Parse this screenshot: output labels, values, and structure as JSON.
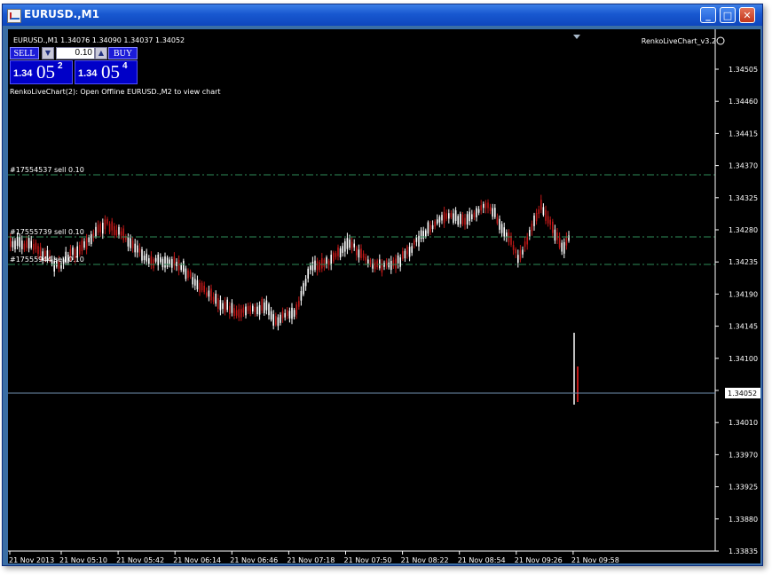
{
  "window": {
    "title": "EURUSD.,M1",
    "minimize_glyph": "_",
    "maximize_glyph": "□",
    "close_glyph": "✕"
  },
  "chart": {
    "symbol_line": "EURUSD.,M1  1.34076 1.34090 1.34037 1.34052",
    "indicator_name": "RenkoLiveChart_v3.2",
    "indicator_message": "RenkoLiveChart(2): Open Offline EURUSD.,M2 to view chart",
    "colors": {
      "background": "#000000",
      "bull_candle": "#ffffff",
      "bear_candle": "#c01818",
      "order_line": "#2e8b57",
      "bid_line": "#6f8fb0"
    }
  },
  "trade_panel": {
    "sell_label": "SELL",
    "buy_label": "BUY",
    "volume": "0.10",
    "sell_price": {
      "prefix": "1.34",
      "big": "05",
      "sup": "2"
    },
    "buy_price": {
      "prefix": "1.34",
      "big": "05",
      "sup": "4"
    },
    "down_arrow": "▼",
    "up_arrow": "▲"
  },
  "orders": [
    {
      "label": "#17554537 sell 0.10",
      "price": 1.34357
    },
    {
      "label": "#17555739 sell 0.10",
      "price": 1.34265
    },
    {
      "label": "#17555944 sell 0.10",
      "price": 1.34225
    }
  ],
  "price_axis": {
    "ticks": [
      "1.34505",
      "1.34460",
      "1.34415",
      "1.34370",
      "1.34325",
      "1.34280",
      "1.34235",
      "1.34190",
      "1.34145",
      "1.34100",
      "1.34055",
      "1.34010",
      "1.33970",
      "1.33925",
      "1.33880",
      "1.33835"
    ],
    "current_price": "1.34052"
  },
  "time_axis": {
    "labels": [
      "21 Nov 2013",
      "21 Nov 05:10",
      "21 Nov 05:42",
      "21 Nov 06:14",
      "21 Nov 06:46",
      "21 Nov 07:18",
      "21 Nov 07:50",
      "21 Nov 08:22",
      "21 Nov 08:54",
      "21 Nov 09:26",
      "21 Nov 09:58"
    ]
  }
}
